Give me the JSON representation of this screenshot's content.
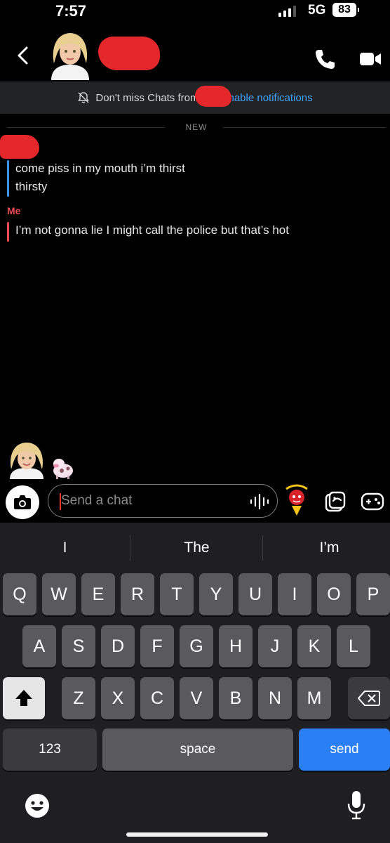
{
  "status_bar": {
    "time": "7:57",
    "network": "5G",
    "battery": "83"
  },
  "header": {
    "avatar": "bitmoji-avatar",
    "icons": [
      "back-chevron-icon",
      "phone-icon",
      "video-camera-icon"
    ]
  },
  "banner": {
    "text": "Don't miss Chats from",
    "link": "nable notifications",
    "icon": "bell-off-icon"
  },
  "divider": {
    "label": "NEW"
  },
  "messages": [
    {
      "sender": "",
      "color": "#3b95ea",
      "lines": [
        "come piss in my mouth i’m thirst",
        "thirsty"
      ]
    },
    {
      "sender": "Me",
      "color": "#f04a55",
      "lines": [
        "I’m not gonna lie I might call the police but that’s hot"
      ]
    }
  ],
  "chat_input": {
    "placeholder": "Send a chat"
  },
  "keyboard": {
    "suggestions": [
      "I",
      "The",
      "I’m"
    ],
    "row1": [
      "Q",
      "W",
      "E",
      "R",
      "T",
      "Y",
      "U",
      "I",
      "O",
      "P"
    ],
    "row2": [
      "A",
      "S",
      "D",
      "F",
      "G",
      "H",
      "J",
      "K",
      "L"
    ],
    "row3": [
      "Z",
      "X",
      "C",
      "V",
      "B",
      "N",
      "M"
    ],
    "numbers_label": "123",
    "space_label": "space",
    "send_label": "send"
  },
  "colors": {
    "link": "#3ea5ff",
    "me": "#f04a55",
    "friend": "#3b95ea",
    "send_key": "#2a7ff5",
    "redaction": "#e3272b"
  }
}
